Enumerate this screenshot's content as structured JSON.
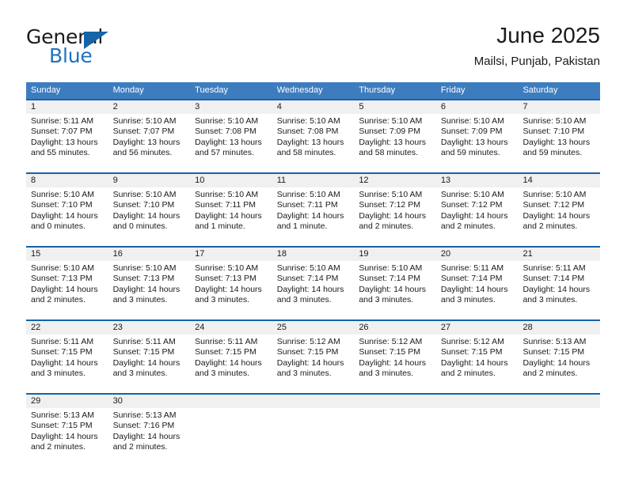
{
  "brand": {
    "name_part1": "General",
    "name_part2": "Blue",
    "logo_icon": "triangle-flag-icon",
    "accent_color": "#1f72bd"
  },
  "header": {
    "title": "June 2025",
    "subtitle": "Mailsi, Punjab, Pakistan"
  },
  "calendar": {
    "header_bg": "#3d7dbf",
    "week_divider_color": "#1564a8",
    "daynumber_bg": "#f0f0f0",
    "weekdays": [
      "Sunday",
      "Monday",
      "Tuesday",
      "Wednesday",
      "Thursday",
      "Friday",
      "Saturday"
    ],
    "weeks": [
      {
        "days": [
          {
            "num": "1",
            "l1": "Sunrise: 5:11 AM",
            "l2": "Sunset: 7:07 PM",
            "l3": "Daylight: 13 hours",
            "l4": "and 55 minutes."
          },
          {
            "num": "2",
            "l1": "Sunrise: 5:10 AM",
            "l2": "Sunset: 7:07 PM",
            "l3": "Daylight: 13 hours",
            "l4": "and 56 minutes."
          },
          {
            "num": "3",
            "l1": "Sunrise: 5:10 AM",
            "l2": "Sunset: 7:08 PM",
            "l3": "Daylight: 13 hours",
            "l4": "and 57 minutes."
          },
          {
            "num": "4",
            "l1": "Sunrise: 5:10 AM",
            "l2": "Sunset: 7:08 PM",
            "l3": "Daylight: 13 hours",
            "l4": "and 58 minutes."
          },
          {
            "num": "5",
            "l1": "Sunrise: 5:10 AM",
            "l2": "Sunset: 7:09 PM",
            "l3": "Daylight: 13 hours",
            "l4": "and 58 minutes."
          },
          {
            "num": "6",
            "l1": "Sunrise: 5:10 AM",
            "l2": "Sunset: 7:09 PM",
            "l3": "Daylight: 13 hours",
            "l4": "and 59 minutes."
          },
          {
            "num": "7",
            "l1": "Sunrise: 5:10 AM",
            "l2": "Sunset: 7:10 PM",
            "l3": "Daylight: 13 hours",
            "l4": "and 59 minutes."
          }
        ]
      },
      {
        "days": [
          {
            "num": "8",
            "l1": "Sunrise: 5:10 AM",
            "l2": "Sunset: 7:10 PM",
            "l3": "Daylight: 14 hours",
            "l4": "and 0 minutes."
          },
          {
            "num": "9",
            "l1": "Sunrise: 5:10 AM",
            "l2": "Sunset: 7:10 PM",
            "l3": "Daylight: 14 hours",
            "l4": "and 0 minutes."
          },
          {
            "num": "10",
            "l1": "Sunrise: 5:10 AM",
            "l2": "Sunset: 7:11 PM",
            "l3": "Daylight: 14 hours",
            "l4": "and 1 minute."
          },
          {
            "num": "11",
            "l1": "Sunrise: 5:10 AM",
            "l2": "Sunset: 7:11 PM",
            "l3": "Daylight: 14 hours",
            "l4": "and 1 minute."
          },
          {
            "num": "12",
            "l1": "Sunrise: 5:10 AM",
            "l2": "Sunset: 7:12 PM",
            "l3": "Daylight: 14 hours",
            "l4": "and 2 minutes."
          },
          {
            "num": "13",
            "l1": "Sunrise: 5:10 AM",
            "l2": "Sunset: 7:12 PM",
            "l3": "Daylight: 14 hours",
            "l4": "and 2 minutes."
          },
          {
            "num": "14",
            "l1": "Sunrise: 5:10 AM",
            "l2": "Sunset: 7:12 PM",
            "l3": "Daylight: 14 hours",
            "l4": "and 2 minutes."
          }
        ]
      },
      {
        "days": [
          {
            "num": "15",
            "l1": "Sunrise: 5:10 AM",
            "l2": "Sunset: 7:13 PM",
            "l3": "Daylight: 14 hours",
            "l4": "and 2 minutes."
          },
          {
            "num": "16",
            "l1": "Sunrise: 5:10 AM",
            "l2": "Sunset: 7:13 PM",
            "l3": "Daylight: 14 hours",
            "l4": "and 3 minutes."
          },
          {
            "num": "17",
            "l1": "Sunrise: 5:10 AM",
            "l2": "Sunset: 7:13 PM",
            "l3": "Daylight: 14 hours",
            "l4": "and 3 minutes."
          },
          {
            "num": "18",
            "l1": "Sunrise: 5:10 AM",
            "l2": "Sunset: 7:14 PM",
            "l3": "Daylight: 14 hours",
            "l4": "and 3 minutes."
          },
          {
            "num": "19",
            "l1": "Sunrise: 5:10 AM",
            "l2": "Sunset: 7:14 PM",
            "l3": "Daylight: 14 hours",
            "l4": "and 3 minutes."
          },
          {
            "num": "20",
            "l1": "Sunrise: 5:11 AM",
            "l2": "Sunset: 7:14 PM",
            "l3": "Daylight: 14 hours",
            "l4": "and 3 minutes."
          },
          {
            "num": "21",
            "l1": "Sunrise: 5:11 AM",
            "l2": "Sunset: 7:14 PM",
            "l3": "Daylight: 14 hours",
            "l4": "and 3 minutes."
          }
        ]
      },
      {
        "days": [
          {
            "num": "22",
            "l1": "Sunrise: 5:11 AM",
            "l2": "Sunset: 7:15 PM",
            "l3": "Daylight: 14 hours",
            "l4": "and 3 minutes."
          },
          {
            "num": "23",
            "l1": "Sunrise: 5:11 AM",
            "l2": "Sunset: 7:15 PM",
            "l3": "Daylight: 14 hours",
            "l4": "and 3 minutes."
          },
          {
            "num": "24",
            "l1": "Sunrise: 5:11 AM",
            "l2": "Sunset: 7:15 PM",
            "l3": "Daylight: 14 hours",
            "l4": "and 3 minutes."
          },
          {
            "num": "25",
            "l1": "Sunrise: 5:12 AM",
            "l2": "Sunset: 7:15 PM",
            "l3": "Daylight: 14 hours",
            "l4": "and 3 minutes."
          },
          {
            "num": "26",
            "l1": "Sunrise: 5:12 AM",
            "l2": "Sunset: 7:15 PM",
            "l3": "Daylight: 14 hours",
            "l4": "and 3 minutes."
          },
          {
            "num": "27",
            "l1": "Sunrise: 5:12 AM",
            "l2": "Sunset: 7:15 PM",
            "l3": "Daylight: 14 hours",
            "l4": "and 2 minutes."
          },
          {
            "num": "28",
            "l1": "Sunrise: 5:13 AM",
            "l2": "Sunset: 7:15 PM",
            "l3": "Daylight: 14 hours",
            "l4": "and 2 minutes."
          }
        ]
      },
      {
        "days": [
          {
            "num": "29",
            "l1": "Sunrise: 5:13 AM",
            "l2": "Sunset: 7:15 PM",
            "l3": "Daylight: 14 hours",
            "l4": "and 2 minutes."
          },
          {
            "num": "30",
            "l1": "Sunrise: 5:13 AM",
            "l2": "Sunset: 7:16 PM",
            "l3": "Daylight: 14 hours",
            "l4": "and 2 minutes."
          },
          {
            "num": "",
            "l1": "",
            "l2": "",
            "l3": "",
            "l4": ""
          },
          {
            "num": "",
            "l1": "",
            "l2": "",
            "l3": "",
            "l4": ""
          },
          {
            "num": "",
            "l1": "",
            "l2": "",
            "l3": "",
            "l4": ""
          },
          {
            "num": "",
            "l1": "",
            "l2": "",
            "l3": "",
            "l4": ""
          },
          {
            "num": "",
            "l1": "",
            "l2": "",
            "l3": "",
            "l4": ""
          }
        ]
      }
    ]
  }
}
